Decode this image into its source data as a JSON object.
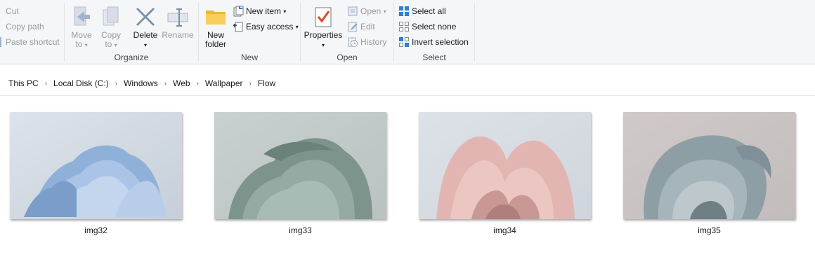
{
  "ribbon": {
    "clipboard": {
      "cut": "Cut",
      "copy_path": "Copy path",
      "paste_shortcut": "Paste shortcut"
    },
    "organize": {
      "move_to": [
        "Move",
        "to"
      ],
      "copy_to": [
        "Copy",
        "to"
      ],
      "delete": "Delete",
      "rename": "Rename",
      "group_label": "Organize"
    },
    "new": {
      "new_folder": [
        "New",
        "folder"
      ],
      "new_item": "New item",
      "easy_access": "Easy access",
      "group_label": "New"
    },
    "open": {
      "properties": "Properties",
      "open": "Open",
      "edit": "Edit",
      "history": "History",
      "group_label": "Open"
    },
    "select": {
      "select_all": "Select all",
      "select_none": "Select none",
      "invert_selection": "Invert selection",
      "group_label": "Select"
    }
  },
  "breadcrumb": [
    "This PC",
    "Local Disk (C:)",
    "Windows",
    "Web",
    "Wallpaper",
    "Flow"
  ],
  "files": [
    {
      "name": "img32",
      "palette": "blue"
    },
    {
      "name": "img33",
      "palette": "sage"
    },
    {
      "name": "img34",
      "palette": "pink"
    },
    {
      "name": "img35",
      "palette": "slate"
    }
  ],
  "colors": {
    "accent": "#1e6fbf",
    "ribbon_bg": "#f5f6f7",
    "disabled_text": "#9a9a9a"
  }
}
